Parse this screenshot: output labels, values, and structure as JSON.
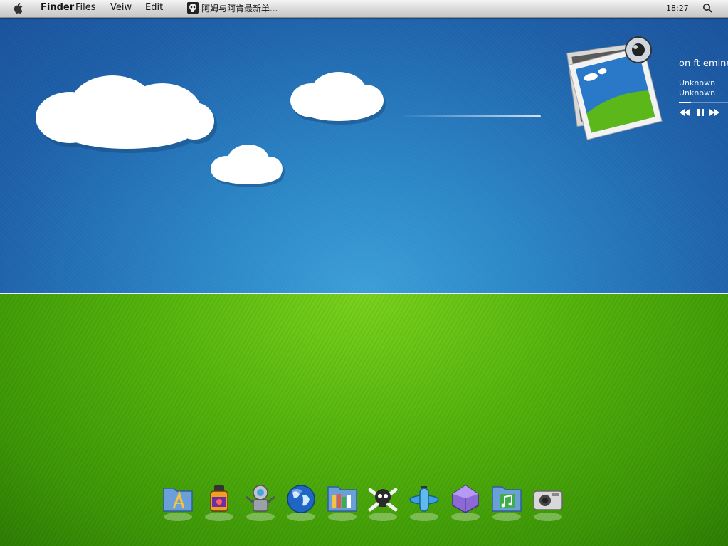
{
  "menubar": {
    "apple_icon": "apple-icon",
    "menus": [
      "Finder",
      "Files",
      "Veiw",
      "Edit"
    ],
    "now_playing_title": "阿姆与阿肯最新单...",
    "clock": "18:27",
    "search_icon": "search-icon"
  },
  "music_widget": {
    "track_title": "on ft emine",
    "artist": "Unknown",
    "album": "Unknown",
    "progress": 0.25,
    "controls": [
      "previous-icon",
      "pause-icon",
      "next-icon"
    ]
  },
  "dock": {
    "items": [
      {
        "name": "applications-folder-icon"
      },
      {
        "name": "potion-bottle-icon"
      },
      {
        "name": "robot-icon"
      },
      {
        "name": "globe-icon"
      },
      {
        "name": "library-folder-icon"
      },
      {
        "name": "skull-crossbones-icon"
      },
      {
        "name": "airplane-icon"
      },
      {
        "name": "purple-gem-icon"
      },
      {
        "name": "music-folder-icon"
      },
      {
        "name": "camera-icon"
      }
    ]
  },
  "colors": {
    "sky": "#1d5fa8",
    "grass": "#55b50d",
    "menubar": "#d9d9d9"
  }
}
